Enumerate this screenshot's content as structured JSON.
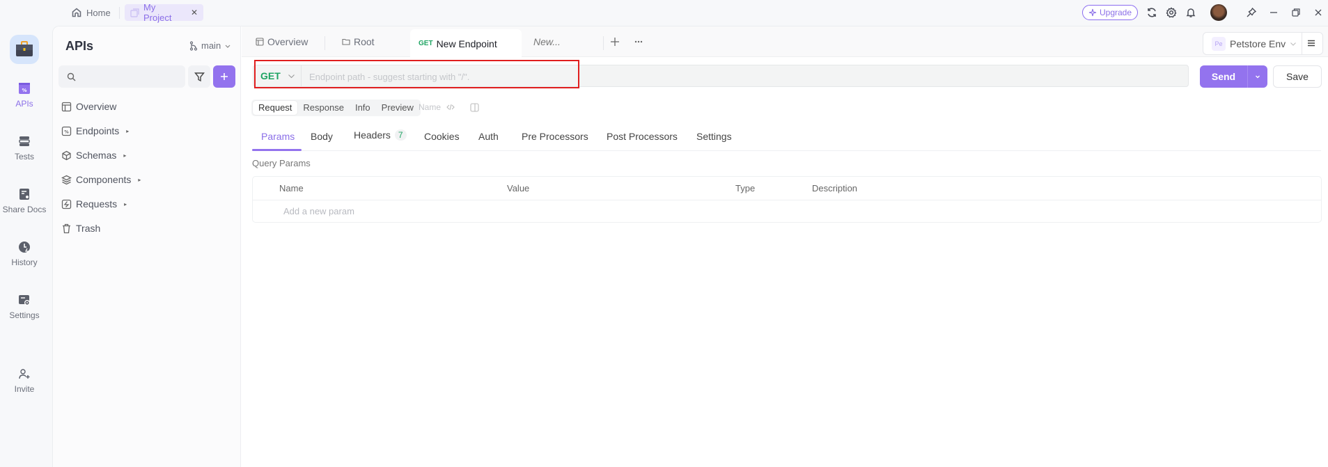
{
  "titlebar": {
    "home_label": "Home",
    "project_tab": "My Project",
    "close_glyph": "✕",
    "upgrade_label": "Upgrade",
    "icons": [
      "refresh-icon",
      "gear-icon",
      "bell-icon",
      "avatar",
      "pin-icon",
      "minimize-icon",
      "maximize-icon",
      "close-icon"
    ]
  },
  "rail": {
    "items": [
      {
        "label": "APIs",
        "icon": "api-icon",
        "active": true
      },
      {
        "label": "Tests",
        "icon": "tests-icon"
      },
      {
        "label": "Share Docs",
        "icon": "share-docs-icon"
      },
      {
        "label": "History",
        "icon": "history-icon"
      },
      {
        "label": "Settings",
        "icon": "settings-icon"
      },
      {
        "label": "Invite",
        "icon": "invite-icon"
      }
    ]
  },
  "sidebar": {
    "title": "APIs",
    "branch": "main",
    "search": {
      "value": "",
      "placeholder": ""
    },
    "items": [
      {
        "label": "Overview",
        "icon": "layout-icon",
        "expandable": false
      },
      {
        "label": "Endpoints",
        "icon": "endpoints-icon",
        "expandable": true
      },
      {
        "label": "Schemas",
        "icon": "cube-icon",
        "expandable": true
      },
      {
        "label": "Components",
        "icon": "layers-icon",
        "expandable": true
      },
      {
        "label": "Requests",
        "icon": "requests-icon",
        "expandable": true
      },
      {
        "label": "Trash",
        "icon": "trash-icon",
        "expandable": false
      }
    ]
  },
  "tabs": [
    {
      "label": "Overview",
      "icon": "layout-icon"
    },
    {
      "label": "Root",
      "icon": "folder-icon"
    },
    {
      "label": "New Endpoint",
      "method": "GET",
      "active": true
    },
    {
      "label": "New...",
      "italic": true
    }
  ],
  "environment": {
    "badge": "Pe",
    "name": "Petstore Env"
  },
  "request": {
    "method": "GET",
    "url_value": "",
    "url_placeholder": "Endpoint path - suggest starting with \"/\".",
    "send_label": "Send",
    "save_label": "Save"
  },
  "view_segments": {
    "items": [
      "Request",
      "Response",
      "Info",
      "Preview"
    ],
    "active": "Request",
    "name_placeholder": "Name"
  },
  "request_tabs": {
    "items": [
      {
        "label": "Params",
        "active": true
      },
      {
        "label": "Body"
      },
      {
        "label": "Headers",
        "count": "7"
      },
      {
        "label": "Cookies"
      },
      {
        "label": "Auth"
      },
      {
        "label": "Pre Processors"
      },
      {
        "label": "Post Processors"
      },
      {
        "label": "Settings"
      }
    ]
  },
  "query_params": {
    "title": "Query Params",
    "columns": [
      "Name",
      "Value",
      "Type",
      "Description"
    ],
    "rows": [],
    "add_placeholder": "Add a new param"
  },
  "colors": {
    "accent": "#9373ee",
    "method_get": "#1fa463",
    "highlight": "#e01e1e"
  }
}
